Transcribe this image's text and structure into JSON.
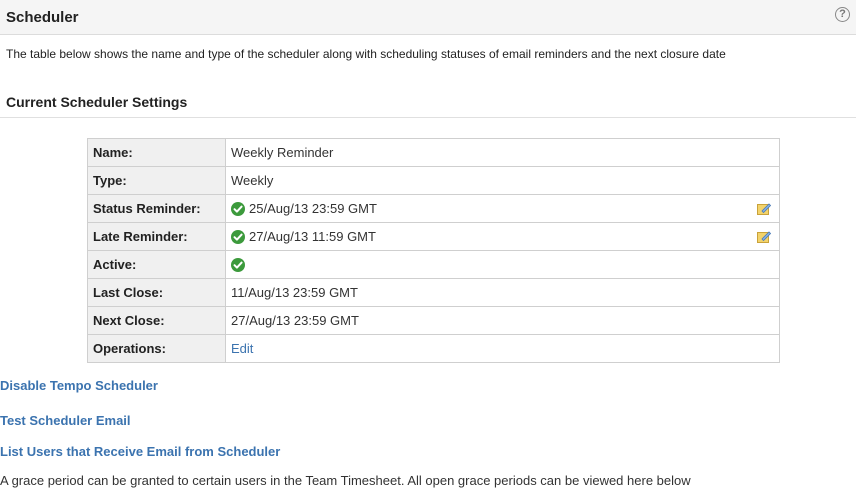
{
  "header": {
    "title": "Scheduler",
    "help_icon": "question-circle-icon",
    "help_glyph": "?"
  },
  "description": "The table below shows the name and type of the scheduler along with scheduling statuses of email reminders and the next closure date",
  "section": {
    "title": "Current Scheduler Settings"
  },
  "settings": {
    "name_label": "Name:",
    "name_value": "Weekly Reminder",
    "type_label": "Type:",
    "type_value": "Weekly",
    "status_label": "Status Reminder:",
    "status_value": "25/Aug/13 23:59 GMT",
    "late_label": "Late Reminder:",
    "late_value": "27/Aug/13 11:59 GMT",
    "active_label": "Active:",
    "last_label": "Last Close:",
    "last_value": "11/Aug/13 23:59 GMT",
    "next_label": "Next Close:",
    "next_value": "27/Aug/13 23:59 GMT",
    "ops_label": "Operations:",
    "ops_link": "Edit"
  },
  "links": {
    "disable": "Disable Tempo Scheduler",
    "test": "Test Scheduler Email",
    "list": "List Users that Receive Email from Scheduler"
  },
  "footer": "A grace period can be granted to certain users in the Team Timesheet. All open grace periods can be viewed here below",
  "colors": {
    "link": "#3b73af",
    "check": "#3c9a3c",
    "key_bg": "#f0f0f0"
  }
}
